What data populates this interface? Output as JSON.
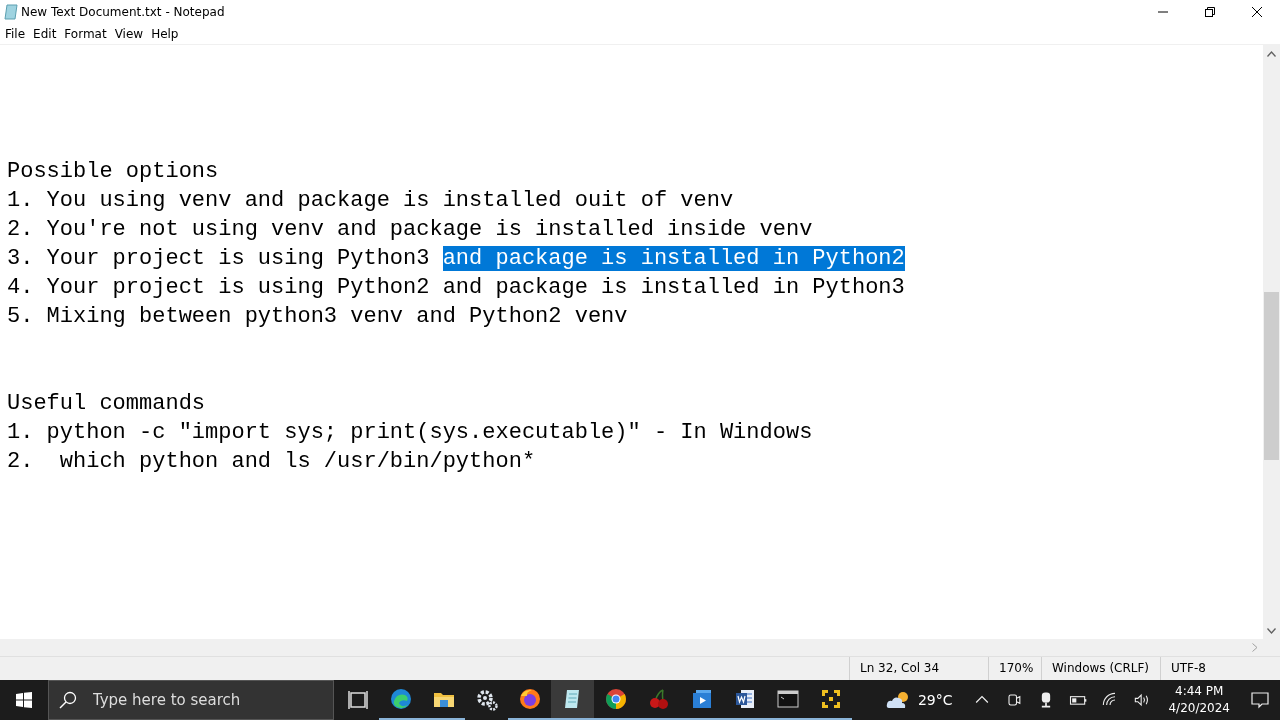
{
  "window": {
    "title": "New Text Document.txt - Notepad"
  },
  "menu": [
    "File",
    "Edit",
    "Format",
    "View",
    "Help"
  ],
  "editor": {
    "sections": [
      {
        "lines": [
          [
            {
              "text": "Possible options",
              "selected": false
            }
          ],
          [
            {
              "text": "1. You using venv and package is installed ouit of venv",
              "selected": false
            }
          ],
          [
            {
              "text": "2. You're not using venv and package is installed inside venv",
              "selected": false
            }
          ],
          [
            {
              "text": "3. Your project is using Python3 ",
              "selected": false
            },
            {
              "text": "and package is installed in Python2",
              "selected": true
            }
          ],
          [
            {
              "text": "4. Your project is using Python2 and package is installed in Python3",
              "selected": false
            }
          ],
          [
            {
              "text": "5. Mixing between python3 venv and Python2 venv",
              "selected": false
            }
          ]
        ]
      },
      {
        "lines": [
          [
            {
              "text": "Useful commands",
              "selected": false
            }
          ],
          [
            {
              "text": "1. python -c \"import sys; print(sys.executable)\" - In Windows",
              "selected": false
            }
          ],
          [
            {
              "text": "2.  which python and ls /usr/bin/python*",
              "selected": false
            }
          ]
        ]
      }
    ]
  },
  "status_bar": [
    "Ln 32, Col 34",
    "170%",
    "Windows (CRLF)",
    "UTF-8"
  ],
  "taskbar": {
    "search": {
      "placeholder": "Type here to search"
    },
    "apps": [
      {
        "kind": "taskview",
        "running": false,
        "selected": false
      },
      {
        "kind": "edge",
        "running": true,
        "selected": false
      },
      {
        "kind": "folder",
        "running": true,
        "selected": false
      },
      {
        "kind": "gear",
        "running": false,
        "selected": false
      },
      {
        "kind": "firefox",
        "running": true,
        "selected": false
      },
      {
        "kind": "notepad",
        "running": true,
        "selected": true
      },
      {
        "kind": "chrome",
        "running": true,
        "selected": false
      },
      {
        "kind": "cherry",
        "running": true,
        "selected": false
      },
      {
        "kind": "media",
        "running": true,
        "selected": false
      },
      {
        "kind": "word",
        "running": true,
        "selected": false
      },
      {
        "kind": "terminal",
        "running": true,
        "selected": false
      },
      {
        "kind": "arrows",
        "running": true,
        "selected": false
      }
    ],
    "weather": "29°C",
    "tray": [
      {
        "kind": "chevron"
      },
      {
        "kind": "meet"
      },
      {
        "kind": "mic"
      },
      {
        "kind": "battery"
      },
      {
        "kind": "wifi"
      },
      {
        "kind": "volume"
      }
    ],
    "time": "4:44 PM",
    "date": "4/20/2024"
  }
}
